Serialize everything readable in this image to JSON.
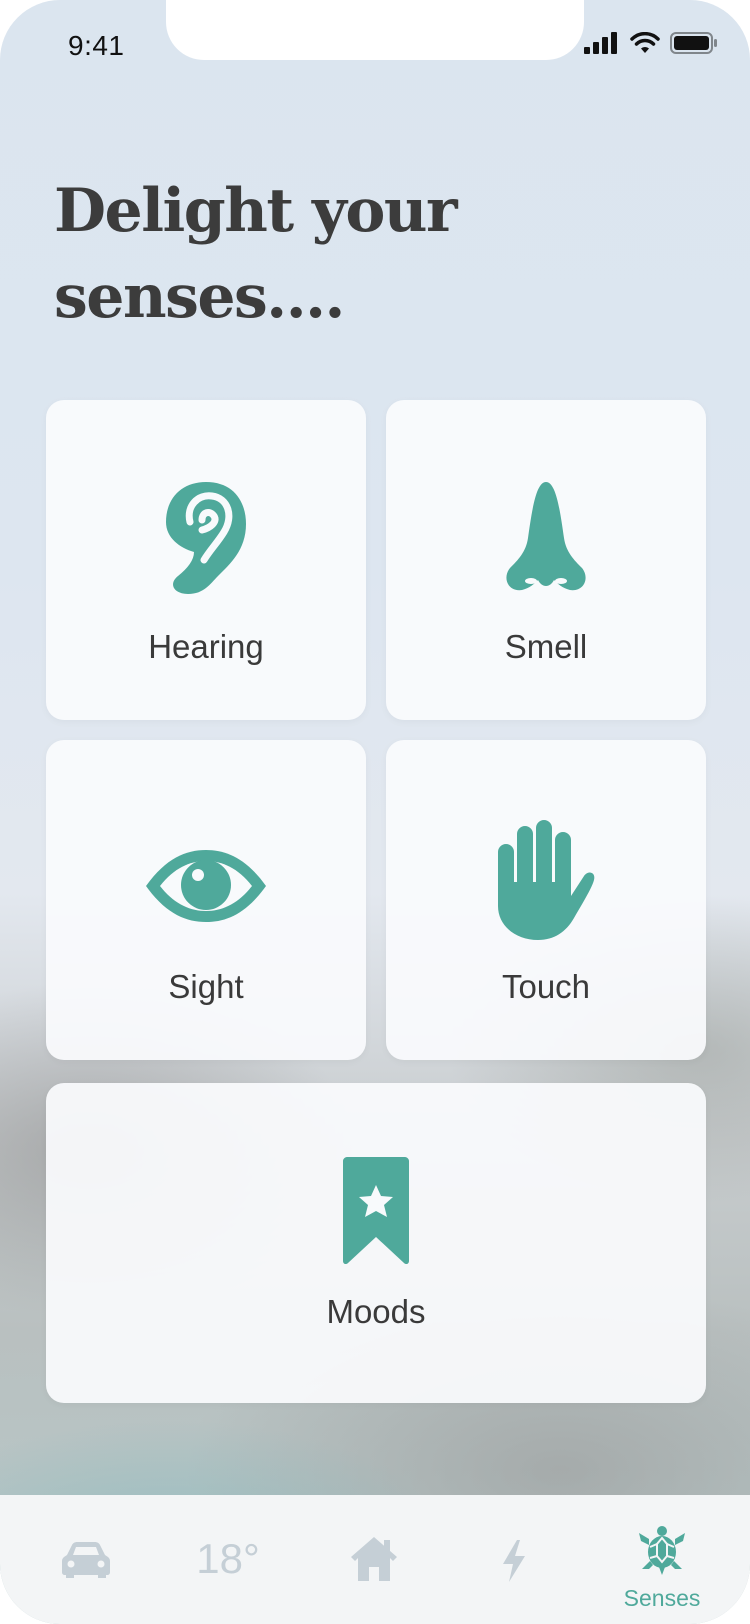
{
  "status_bar": {
    "time": "9:41"
  },
  "headline": "Delight your senses....",
  "accent_color": "#4fa99b",
  "cards": {
    "hearing": {
      "label": "Hearing",
      "icon": "ear-icon"
    },
    "smell": {
      "label": "Smell",
      "icon": "nose-icon"
    },
    "sight": {
      "label": "Sight",
      "icon": "eye-icon"
    },
    "touch": {
      "label": "Touch",
      "icon": "hand-icon"
    },
    "moods": {
      "label": "Moods",
      "icon": "bookmark-star-icon"
    }
  },
  "tab_bar": {
    "car": {
      "icon": "car-icon"
    },
    "temperature": {
      "value": "18°"
    },
    "home": {
      "icon": "home-icon"
    },
    "energy": {
      "icon": "lightning-icon"
    },
    "senses": {
      "label": "Senses",
      "icon": "turtle-icon",
      "active": true
    }
  }
}
